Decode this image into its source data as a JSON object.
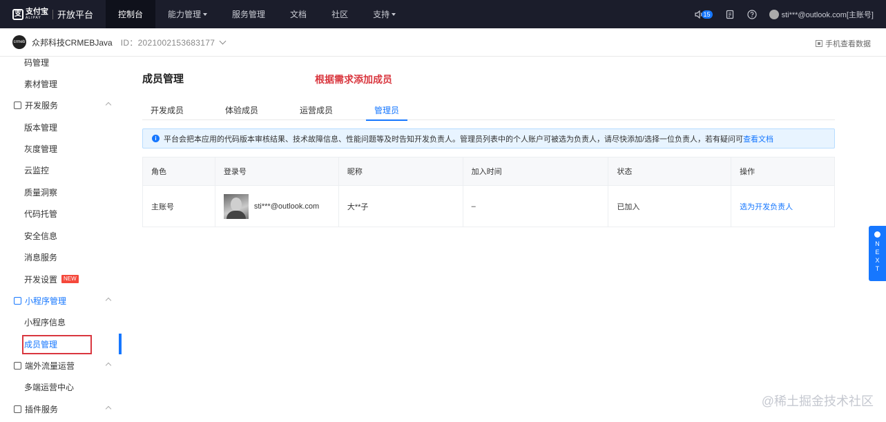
{
  "topbar": {
    "logo_cn": "支付宝",
    "logo_en": "ALIPAY",
    "platform": "开放平台",
    "nav": [
      {
        "label": "控制台",
        "active": true
      },
      {
        "label": "能力管理",
        "dropdown": true
      },
      {
        "label": "服务管理"
      },
      {
        "label": "文档"
      },
      {
        "label": "社区"
      },
      {
        "label": "支持",
        "dropdown": true
      }
    ],
    "notification_count": "15",
    "user": "sti***@outlook.com[主账号]"
  },
  "app": {
    "name": "众邦科技CRMEBJava",
    "id_label": "ID：2021002153683177",
    "mobile_data": "手机查看数据"
  },
  "sidebar": {
    "items": [
      {
        "label": "码管理",
        "kind": "sub"
      },
      {
        "label": "素材管理",
        "kind": "sub"
      },
      {
        "label": "开发服务",
        "kind": "group"
      },
      {
        "label": "版本管理",
        "kind": "sub"
      },
      {
        "label": "灰度管理",
        "kind": "sub"
      },
      {
        "label": "云监控",
        "kind": "sub"
      },
      {
        "label": "质量洞察",
        "kind": "sub"
      },
      {
        "label": "代码托管",
        "kind": "sub"
      },
      {
        "label": "安全信息",
        "kind": "sub"
      },
      {
        "label": "消息服务",
        "kind": "sub"
      },
      {
        "label": "开发设置",
        "kind": "sub",
        "badge": "NEW"
      },
      {
        "label": "小程序管理",
        "kind": "group",
        "active": true
      },
      {
        "label": "小程序信息",
        "kind": "sub"
      },
      {
        "label": "成员管理",
        "kind": "sub",
        "selected": true
      },
      {
        "label": "端外流量运营",
        "kind": "group"
      },
      {
        "label": "多端运营中心",
        "kind": "sub"
      },
      {
        "label": "插件服务",
        "kind": "group"
      }
    ]
  },
  "main": {
    "title": "成员管理",
    "annotation": "根据需求添加成员",
    "tabs": [
      "开发成员",
      "体验成员",
      "运营成员",
      "管理员"
    ],
    "active_tab": 3,
    "notice_text": "平台会把本应用的代码版本审核结果、技术故障信息、性能问题等及时告知开发负责人。管理员列表中的个人账户可被选为负责人，请尽快添加/选择一位负责人，若有疑问可",
    "notice_link": "查看文档",
    "table": {
      "headers": [
        "角色",
        "登录号",
        "昵称",
        "加入时间",
        "状态",
        "操作"
      ],
      "rows": [
        {
          "role": "主账号",
          "login": "sti***@outlook.com",
          "nickname": "大**子",
          "join_time": "–",
          "status": "已加入",
          "action": "选为开发负责人"
        }
      ]
    }
  },
  "next_tab": [
    "N",
    "E",
    "X",
    "T"
  ],
  "watermark": "@稀土掘金技术社区",
  "colors": {
    "accent": "#1677ff",
    "annotation": "#d9363e",
    "topbar": "#1b1d2b"
  }
}
